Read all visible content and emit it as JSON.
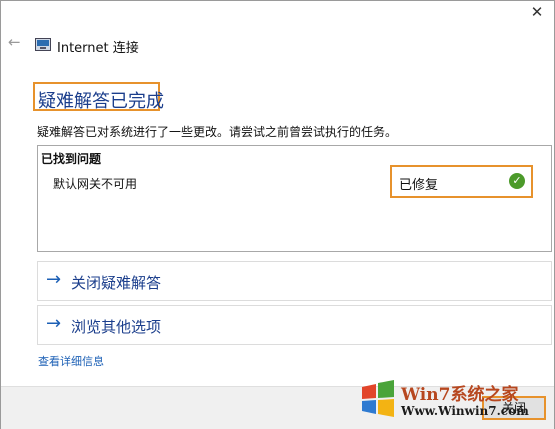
{
  "window": {
    "close_glyph": "✕",
    "back_glyph": "←",
    "title": "Internet 连接",
    "icon": "network-adapter-icon"
  },
  "main": {
    "heading": "疑难解答已完成",
    "description": "疑难解答已对系统进行了一些更改。请尝试之前曾尝试执行的任务。",
    "problems_header": "已找到问题",
    "problems": [
      {
        "name": "默认网关不可用",
        "status": "已修复",
        "status_icon": "check-icon"
      }
    ],
    "actions": [
      {
        "arrow": "→",
        "label": "关闭疑难解答"
      },
      {
        "arrow": "→",
        "label": "浏览其他选项"
      }
    ],
    "details_link": "查看详细信息"
  },
  "footer": {
    "close_button": "关闭"
  },
  "watermark": {
    "brand": "Win7系统之家",
    "url": "Www.Winwin7.com"
  },
  "colors": {
    "highlight": "#e7922c",
    "heading": "#1b3e8c",
    "link": "#1b5fb5",
    "success": "#4c9a2a"
  }
}
